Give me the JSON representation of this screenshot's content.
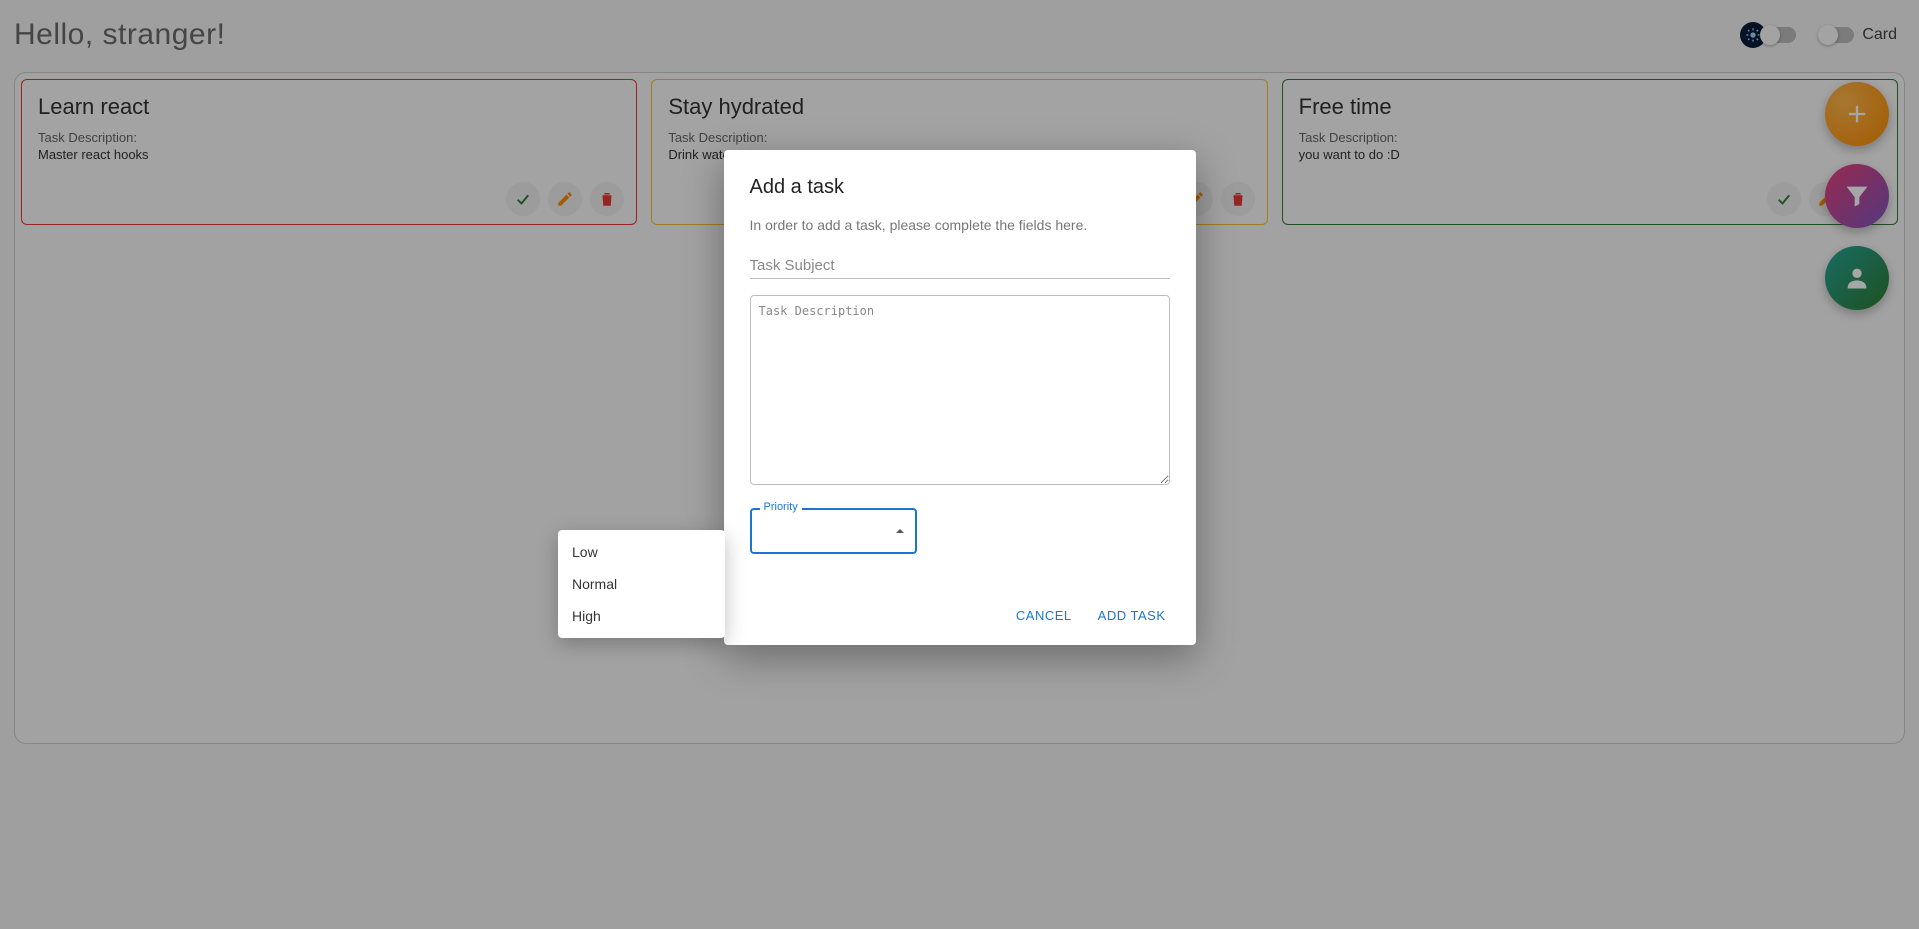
{
  "header": {
    "greeting": "Hello, stranger!",
    "card_label": "Card"
  },
  "tasks": [
    {
      "title": "Learn react",
      "desc_label": "Task Description:",
      "desc": "Master react hooks",
      "priority_color": "red"
    },
    {
      "title": "Stay hydrated",
      "desc_label": "Task Description:",
      "desc": "Drink water",
      "priority_color": "yellow"
    },
    {
      "title": "Free time",
      "desc_label": "Task Description:",
      "desc": "you want to do :D",
      "priority_color": "green"
    }
  ],
  "dialog": {
    "title": "Add a task",
    "subtext": "In order to add a task, please complete the fields here.",
    "subject_placeholder": "Task Subject",
    "desc_placeholder": "Task Description",
    "priority_label": "Priority",
    "priority_options": [
      "Low",
      "Normal",
      "High"
    ],
    "cancel": "CANCEL",
    "submit": "ADD TASK"
  },
  "icons": {
    "check": "check-icon",
    "edit": "pencil-icon",
    "delete": "trash-icon",
    "add": "plus-icon",
    "filter": "funnel-icon",
    "user": "person-icon",
    "sun": "sun-icon",
    "up_caret": "caret-up-icon"
  }
}
